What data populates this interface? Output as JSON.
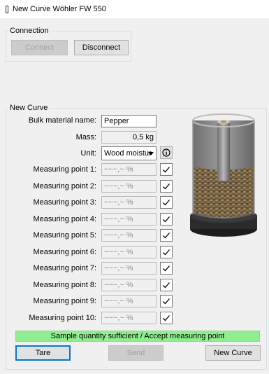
{
  "window": {
    "title": "New Curve Wöhler FW 550"
  },
  "connection": {
    "legend": "Connection",
    "connect_label": "Connect",
    "disconnect_label": "Disconnect"
  },
  "new_curve": {
    "legend": "New Curve",
    "bulk_material_label": "Bulk material name:",
    "bulk_material_value": "Pepper",
    "mass_label": "Mass:",
    "mass_value": "0,5 kg",
    "unit_label": "Unit:",
    "unit_value": "Wood moistur",
    "measuring_points": [
      {
        "label": "Measuring point 1:",
        "value": "~~~,~ %"
      },
      {
        "label": "Measuring point 2:",
        "value": "~~~,~ %"
      },
      {
        "label": "Measuring point 3:",
        "value": "~~~,~ %"
      },
      {
        "label": "Measuring point 4:",
        "value": "~~~,~ %"
      },
      {
        "label": "Measuring point 5:",
        "value": "~~~,~ %"
      },
      {
        "label": "Measuring point 6:",
        "value": "~~~,~ %"
      },
      {
        "label": "Measuring point 7:",
        "value": "~~~,~ %"
      },
      {
        "label": "Measuring point 8:",
        "value": "~~~,~ %"
      },
      {
        "label": "Measuring point 9:",
        "value": "~~~,~ %"
      },
      {
        "label": "Measuring point 10:",
        "value": "~~~,~ %"
      }
    ],
    "status_text": "Sample quantity sufficient / Accept measuring point",
    "status_color": "#90ee90",
    "tare_label": "Tare",
    "send_label": "Send",
    "new_curve_label": "New Curve"
  },
  "icons": {
    "info": "info-icon",
    "accept": "checkmark-icon",
    "device": "measuring-container-image"
  }
}
